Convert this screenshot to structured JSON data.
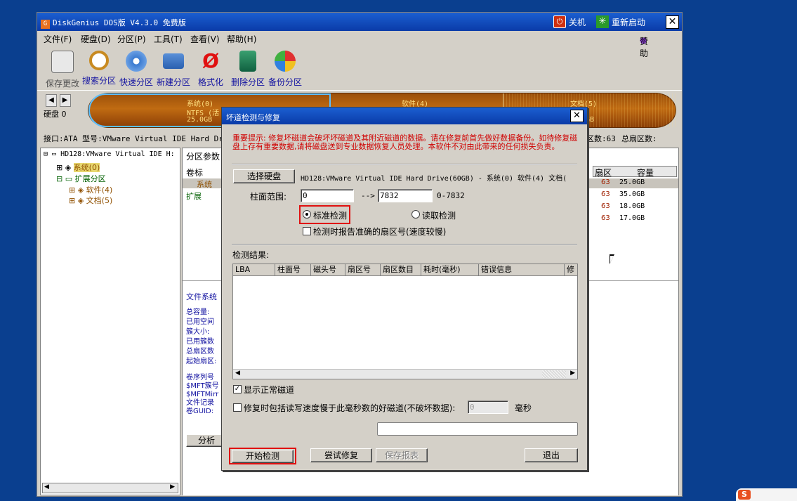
{
  "app": {
    "title": "DiskGenius DOS版 V4.3.0 免费版",
    "logo_text": "G",
    "shutdown_label": "关机",
    "restart_label": "重新启动",
    "close_glyph": "✕",
    "sponsor_label": "赞助"
  },
  "menu": [
    "文件(F)",
    "硬盘(D)",
    "分区(P)",
    "工具(T)",
    "查看(V)",
    "帮助(H)"
  ],
  "toolbar": [
    {
      "label": "保存更改",
      "icon": "save-disk-icon",
      "disabled": true
    },
    {
      "label": "搜索分区",
      "icon": "magnifier-icon"
    },
    {
      "label": "快速分区",
      "icon": "disc-icon"
    },
    {
      "label": "新建分区",
      "icon": "computer-icon"
    },
    {
      "label": "格式化",
      "icon": "format-icon"
    },
    {
      "label": "删除分区",
      "icon": "trash-icon"
    },
    {
      "label": "备份分区",
      "icon": "backup-icon"
    }
  ],
  "disk": {
    "label": "硬盘 0",
    "p0_name": "系统(0)",
    "p0_fs": "NTFS (活",
    "p0_size": "25.0GB",
    "p1_name": "软件(4)",
    "p2_name": "文档(5)",
    "p2_size": "GB"
  },
  "infobar": {
    "left": "接口:ATA  型号:VMware Virtual IDE Hard Driv",
    "right_a": "区数:63",
    "right_b": "总扇区数:"
  },
  "tree": {
    "root": "HD128:VMware Virtual IDE H:",
    "items": [
      "系统(0)",
      "扩展分区",
      "软件(4)",
      "文档(5)"
    ]
  },
  "right": {
    "tab": "分区参数",
    "col_label": "卷标",
    "col_sector": "扇区",
    "col_capacity": "容量",
    "row_labels": [
      "系统",
      "扩展"
    ],
    "rows": [
      {
        "sector": "63",
        "cap": "25.0GB"
      },
      {
        "sector": "63",
        "cap": "35.0GB"
      },
      {
        "sector": "63",
        "cap": "18.0GB"
      },
      {
        "sector": "63",
        "cap": "17.0GB"
      }
    ],
    "fs_title": "文件系统",
    "fields1": [
      "总容量:",
      "已用空间",
      "簇大小:",
      "已用簇数",
      "总扇区数",
      "起始扇区:"
    ],
    "fields2": [
      "卷序列号",
      "$MFT簇号",
      "$MFTMirr",
      "文件记录",
      "卷GUID:"
    ],
    "analyze_button": "分析"
  },
  "dialog": {
    "title": "坏道检测与修复",
    "warning": "重要提示: 修复坏磁道会破坏坏磁道及其附近磁道的数据。请在修复前首先做好数据备份。如待修复磁盘上存有重要数据,请将磁盘送到专业数据恢复人员处理。本软件不对由此带来的任何损失负责。",
    "select_disk_button": "选择硬盘",
    "disk_text": "HD128:VMware Virtual IDE Hard Drive(60GB) - 系统(0) 软件(4) 文档(",
    "cyl_label": "柱面范围:",
    "cyl_from": "0",
    "arrow": "-->",
    "cyl_to": "7832",
    "cyl_hint": "0-7832",
    "radio_standard": "标准检测",
    "radio_read": "读取检测",
    "check_report": "检测时报告准确的扇区号(速度较慢)",
    "result_label": "检测结果:",
    "columns": [
      "LBA",
      "柱面号",
      "磁头号",
      "扇区号",
      "扇区数目",
      "耗时(毫秒)",
      "错误信息",
      "修"
    ],
    "show_normal": "显示正常磁道",
    "include_slow": "修复时包括读写速度慢于此毫秒数的好磁道(不破坏数据):",
    "slow_value": "0",
    "ms_label": "毫秒",
    "start_button": "开始检测",
    "try_repair_button": "尝试修复",
    "save_report_button": "保存报表",
    "exit_button": "退出"
  },
  "colors": {
    "title_blue": "#0a3ba8",
    "desktop": "#0a3f8f",
    "warning_red": "#d00000",
    "highlight_red": "#e01010"
  }
}
